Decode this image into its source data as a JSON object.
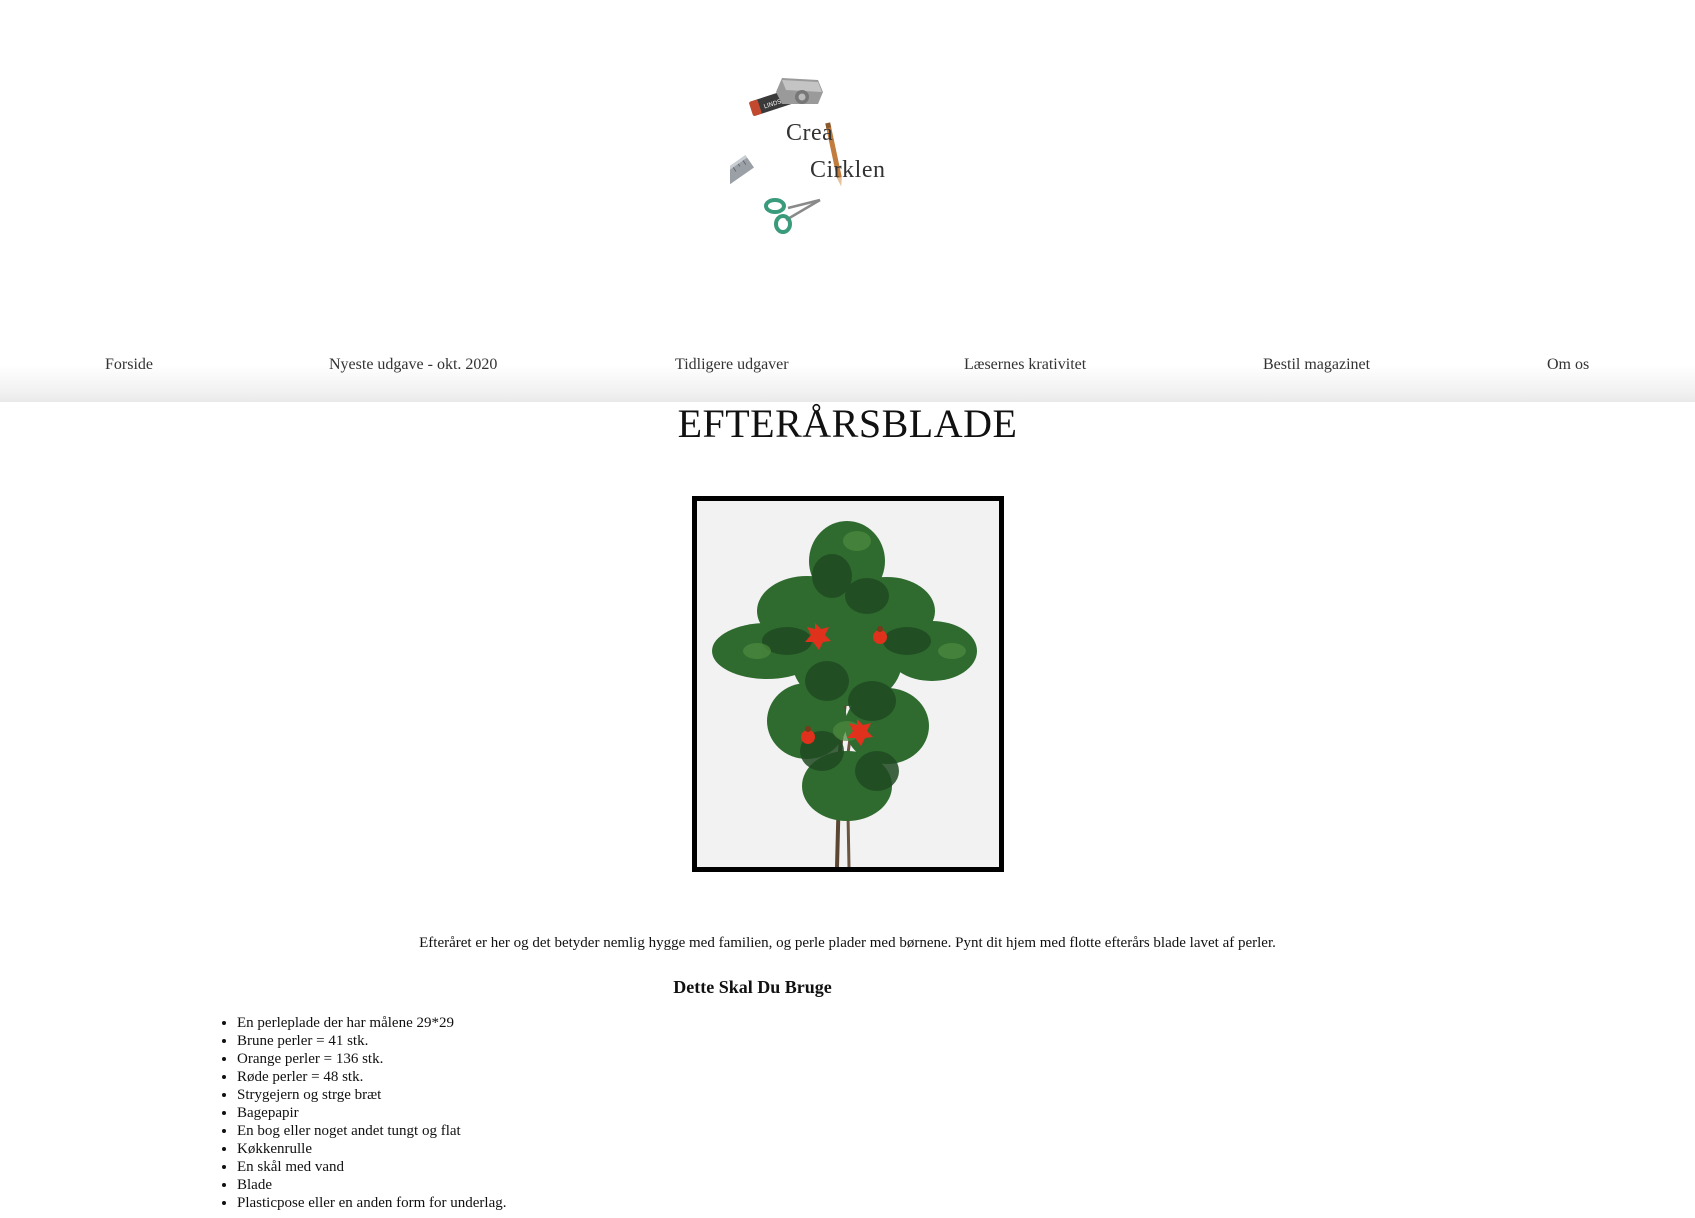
{
  "logo": {
    "line1": "Crea",
    "line2": "Cirklen",
    "eraser_text": "LINDSTRØM"
  },
  "nav": {
    "items": [
      {
        "label": "Forside"
      },
      {
        "label": "Nyeste udgave - okt. 2020"
      },
      {
        "label": "Tidligere udgaver"
      },
      {
        "label": "Læsernes krativitet"
      },
      {
        "label": "Bestil magazinet"
      },
      {
        "label": "Om os"
      }
    ]
  },
  "article": {
    "title": "EFTERÅRSBLADE",
    "intro": "Efteråret er her og det betyder nemlig hygge med familien, og perle plader med børnene. Pynt dit hjem med flotte efterårs blade lavet af perler.",
    "supplies_heading": "Dette Skal Du Bruge",
    "supplies": [
      "En perleplade der har målene 29*29",
      "Brune perler = 41 stk.",
      "Orange perler = 136 stk.",
      "Røde perler = 48 stk.",
      "Strygejern og strge bræt",
      "Bagepapir",
      "En bog eller noget andet tungt og flat",
      "Køkkenrulle",
      "En skål med vand",
      "Blade",
      "Plasticpose eller en anden form for underlag."
    ]
  },
  "colors": {
    "text": "#111111",
    "nav_text": "#333333",
    "leaf_dark": "#1f4a22",
    "leaf_mid": "#2f6b2f",
    "bead_red": "#e0311c",
    "scissors": "#3a9a7c"
  }
}
